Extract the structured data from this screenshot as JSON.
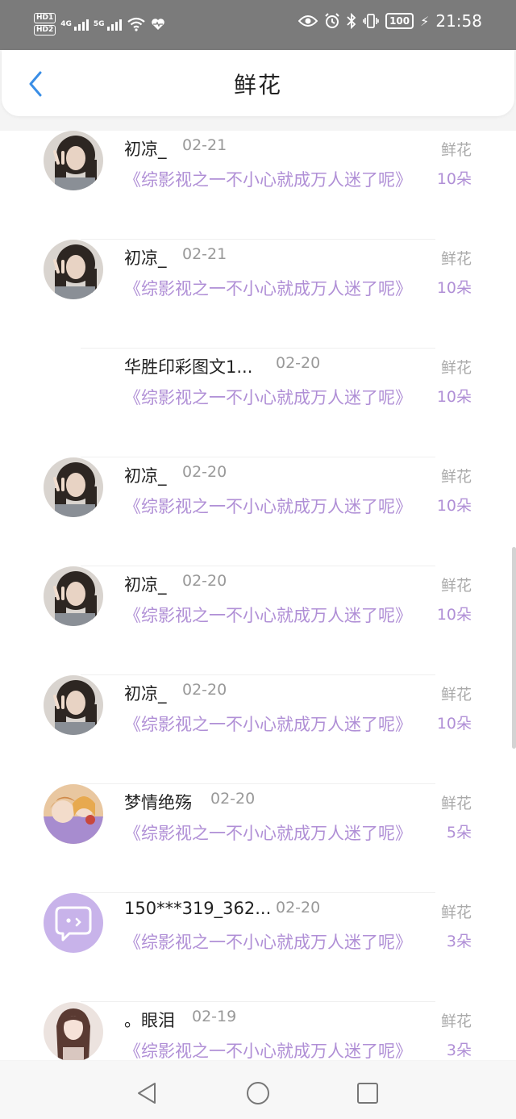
{
  "status_bar": {
    "hd1": "HD1",
    "hd2": "HD2",
    "net1": "4G",
    "net2": "5G",
    "battery": "100",
    "time": "21:58"
  },
  "header": {
    "title": "鲜花"
  },
  "list": [
    {
      "name": "初凉_",
      "date": "02-21",
      "book": "《综影视之一不小心就成万人迷了呢》",
      "kind": "鲜花",
      "count": "10朵",
      "avatar": "photo-girl-curly"
    },
    {
      "name": "初凉_",
      "date": "02-21",
      "book": "《综影视之一不小心就成万人迷了呢》",
      "kind": "鲜花",
      "count": "10朵",
      "avatar": "photo-girl-curly"
    },
    {
      "name": "华胜印彩图文1...",
      "date": "02-20",
      "book": "《综影视之一不小心就成万人迷了呢》",
      "kind": "鲜花",
      "count": "10朵",
      "avatar": "none"
    },
    {
      "name": "初凉_",
      "date": "02-20",
      "book": "《综影视之一不小心就成万人迷了呢》",
      "kind": "鲜花",
      "count": "10朵",
      "avatar": "photo-girl-curly"
    },
    {
      "name": "初凉_",
      "date": "02-20",
      "book": "《综影视之一不小心就成万人迷了呢》",
      "kind": "鲜花",
      "count": "10朵",
      "avatar": "photo-girl-curly"
    },
    {
      "name": "初凉_",
      "date": "02-20",
      "book": "《综影视之一不小心就成万人迷了呢》",
      "kind": "鲜花",
      "count": "10朵",
      "avatar": "photo-girl-curly"
    },
    {
      "name": "梦情绝殇",
      "date": "02-20",
      "book": "《综影视之一不小心就成万人迷了呢》",
      "kind": "鲜花",
      "count": "5朵",
      "avatar": "cartoon-girl"
    },
    {
      "name": "150***319_362...",
      "date": "02-20",
      "book": "《综影视之一不小心就成万人迷了呢》",
      "kind": "鲜花",
      "count": "3朵",
      "avatar": "default-chat-icon"
    },
    {
      "name": "。眼泪",
      "date": "02-19",
      "book": "《综影视之一不小心就成万人迷了呢》",
      "kind": "鲜花",
      "count": "3朵",
      "avatar": "photo-girl-long-hair"
    }
  ],
  "colors": {
    "accent": "#b08fd6",
    "back_arrow": "#3a8ee6"
  }
}
